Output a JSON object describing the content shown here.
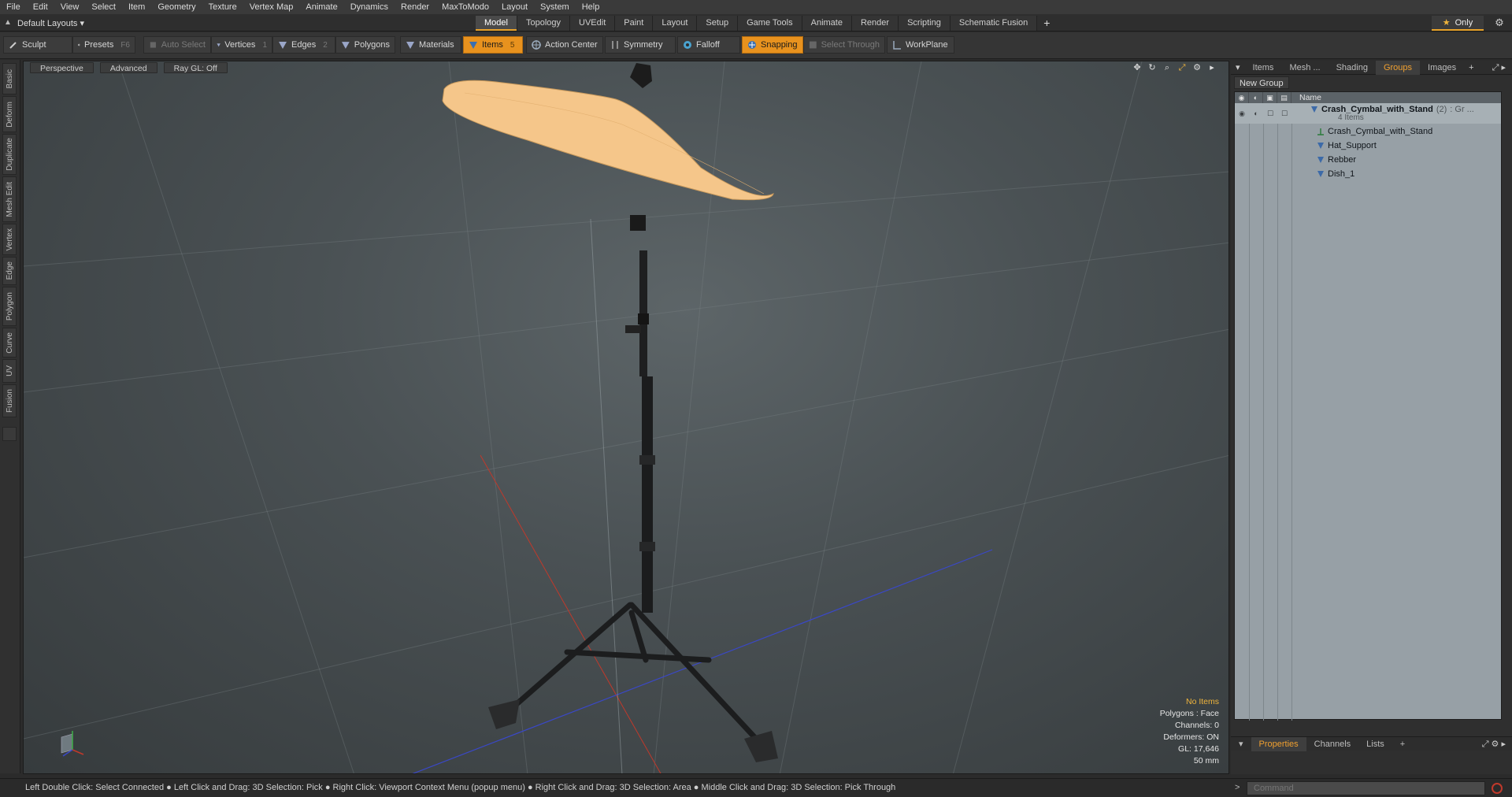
{
  "menu": [
    "File",
    "Edit",
    "View",
    "Select",
    "Item",
    "Geometry",
    "Texture",
    "Vertex Map",
    "Animate",
    "Dynamics",
    "Render",
    "MaxToModo",
    "Layout",
    "System",
    "Help"
  ],
  "layout_selector": {
    "label": "Default Layouts ▾"
  },
  "layout_tabs": [
    {
      "label": "Model",
      "active": true
    },
    {
      "label": "Topology"
    },
    {
      "label": "UVEdit"
    },
    {
      "label": "Paint"
    },
    {
      "label": "Layout"
    },
    {
      "label": "Setup"
    },
    {
      "label": "Game Tools"
    },
    {
      "label": "Animate"
    },
    {
      "label": "Render"
    },
    {
      "label": "Scripting"
    },
    {
      "label": "Schematic Fusion"
    }
  ],
  "layout_plus": "+",
  "only_button": {
    "label": "Only",
    "star": "★"
  },
  "toolbar": {
    "sculpt": "Sculpt",
    "presets": "Presets",
    "presets_key": "F6",
    "auto_select": "Auto Select",
    "vertices": "Vertices",
    "vertices_key": "1",
    "edges": "Edges",
    "edges_key": "2",
    "polygons": "Polygons",
    "materials": "Materials",
    "items": "Items",
    "items_key": "5",
    "action_center": "Action Center",
    "symmetry": "Symmetry",
    "falloff": "Falloff",
    "snapping": "Snapping",
    "select_through": "Select Through",
    "workplane": "WorkPlane"
  },
  "left_tabs": [
    "Basic",
    "Deform",
    "Duplicate",
    "Mesh Edit",
    "Vertex",
    "Edge",
    "Polygon",
    "Curve",
    "UV",
    "Fusion"
  ],
  "viewport": {
    "perspective": "Perspective",
    "advanced": "Advanced",
    "raygl": "Ray GL: Off",
    "info": {
      "no_items": "No Items",
      "polygons": "Polygons : Face",
      "channels": "Channels: 0",
      "deformers": "Deformers: ON",
      "gl": "GL: 17,646",
      "focal": "50 mm"
    }
  },
  "right_panel": {
    "tabs": [
      {
        "label": "Items"
      },
      {
        "label": "Mesh ..."
      },
      {
        "label": "Shading"
      },
      {
        "label": "Groups",
        "active": true
      },
      {
        "label": "Images"
      }
    ],
    "new_group": "New Group",
    "name_header": "Name",
    "root": {
      "name": "Crash_Cymbal_with_Stand",
      "count": "(2)",
      "suffix": ": Gr ...",
      "sub": "4 Items"
    },
    "children": [
      "Crash_Cymbal_with_Stand",
      "Hat_Support",
      "Rebber",
      "Dish_1"
    ],
    "bottom_tabs": [
      {
        "label": "Properties",
        "active": true
      },
      {
        "label": "Channels"
      },
      {
        "label": "Lists"
      }
    ]
  },
  "status": {
    "hints": "Left Double Click: Select Connected ● Left Click and Drag: 3D Selection: Pick ● Right Click: Viewport Context Menu (popup menu) ● Right Click and Drag: 3D Selection: Area ● Middle Click and Drag: 3D Selection: Pick Through",
    "command_placeholder": "Command"
  },
  "colors": {
    "accent": "#e8921e",
    "cymbal": "#f7c98e",
    "stand": "#1e1f20",
    "x_axis": "#c0392b",
    "z_axis": "#3a48c8"
  }
}
